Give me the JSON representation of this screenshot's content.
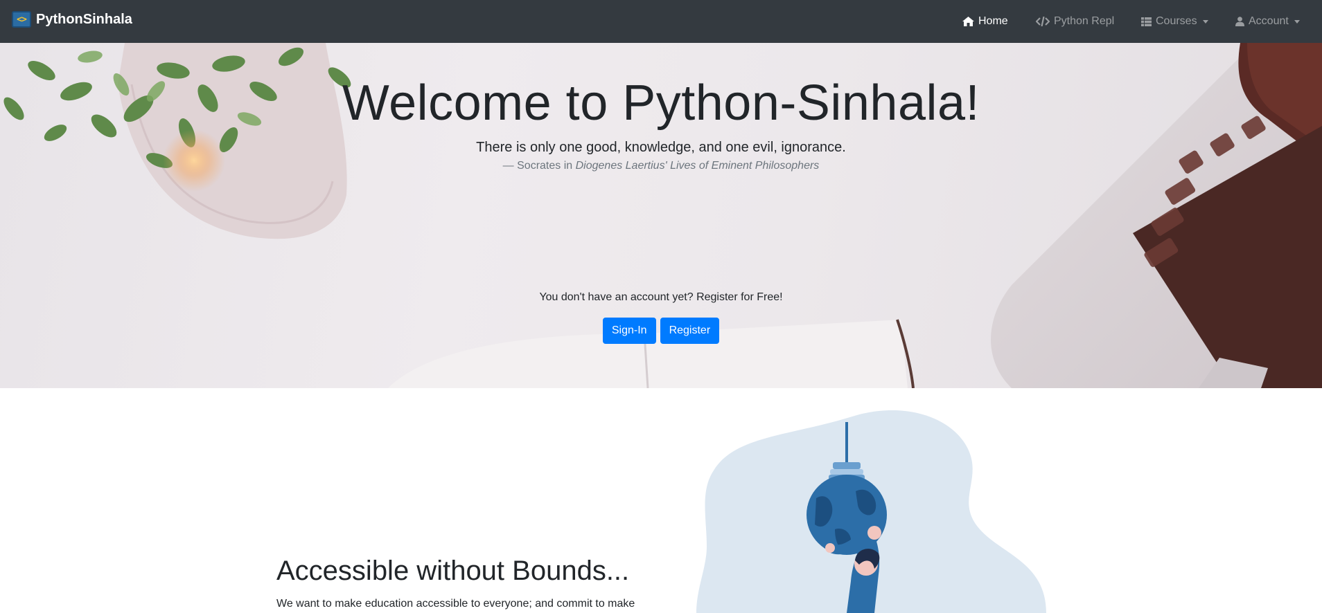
{
  "navbar": {
    "brand": "PythonSinhala",
    "items": [
      {
        "label": "Home",
        "icon": "home-icon",
        "active": true
      },
      {
        "label": "Python Repl",
        "icon": "code-icon",
        "active": false
      },
      {
        "label": "Courses",
        "icon": "list-icon",
        "active": false,
        "dropdown": true
      },
      {
        "label": "Account",
        "icon": "user-icon",
        "active": false,
        "dropdown": true
      }
    ]
  },
  "hero": {
    "title": "Welcome to Python-Sinhala!",
    "quote": "There is only one good, knowledge, and one evil, ignorance.",
    "cite_prefix": "— Socrates in ",
    "cite_source": "Diogenes Laertius' Lives of Eminent Philosophers",
    "register_prompt": "You don't have an account yet? Register for Free!",
    "signin_label": "Sign-In",
    "register_label": "Register"
  },
  "feature": {
    "title": "Accessible without Bounds...",
    "text": "We want to make education accessible to everyone; and commit to make"
  },
  "colors": {
    "navbar_bg": "#343a40",
    "primary": "#007bff",
    "illustration_bg": "#dce7f1",
    "illustration_blue": "#2c6ea8"
  }
}
